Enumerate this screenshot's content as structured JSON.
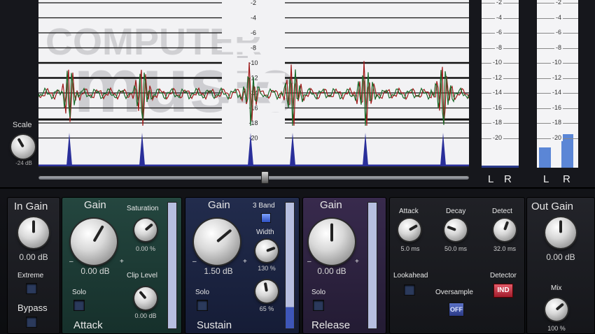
{
  "scope": {
    "scale_label": "Scale",
    "scale_value": "-24 dB",
    "watermark_top": "COMPUTER",
    "watermark_main": "music",
    "db_ticks": [
      "-2",
      "-4",
      "-6",
      "-8",
      "-10",
      "-12",
      "-14",
      "-16",
      "-18",
      "-20"
    ]
  },
  "meters": {
    "input_ticks": [
      "-2",
      "-4",
      "-6",
      "-8",
      "-10",
      "-12",
      "-14",
      "-16",
      "-18",
      "-20"
    ],
    "output_ticks": [
      "-2",
      "-4",
      "-6",
      "-8",
      "-10",
      "-12",
      "-14",
      "-16",
      "-18",
      "-20"
    ],
    "input_l": "L",
    "input_r": "R",
    "output_l": "L",
    "output_r": "R",
    "output_level_l": 0.12,
    "output_level_r": 0.2
  },
  "in_panel": {
    "title": "In Gain",
    "value": "0.00 dB",
    "extreme": "Extreme",
    "bypass": "Bypass"
  },
  "attack_panel": {
    "gain_title": "Gain",
    "gain_value": "0.00 dB",
    "saturation": "Saturation",
    "saturation_value": "0.00 %",
    "clip_level": "Clip Level",
    "clip_value": "0.00 dB",
    "solo": "Solo",
    "name": "Attack",
    "minus": "–",
    "plus": "+"
  },
  "sustain_panel": {
    "gain_title": "Gain",
    "gain_value": "1.50 dB",
    "three_band": "3 Band",
    "width": "Width",
    "width_value": "130 %",
    "third_value": "65 %",
    "solo": "Solo",
    "name": "Sustain",
    "minus": "–",
    "plus": "+"
  },
  "release_panel": {
    "gain_title": "Gain",
    "gain_value": "0.00 dB",
    "solo": "Solo",
    "name": "Release",
    "minus": "–",
    "plus": "+"
  },
  "env_panel": {
    "attack": "Attack",
    "attack_value": "5.0 ms",
    "decay": "Decay",
    "decay_value": "50.0 ms",
    "detect": "Detect",
    "detect_value": "32.0 ms",
    "lookahead": "Lookahead",
    "oversample": "Oversample",
    "oversample_btn": "OFF",
    "detector": "Detector",
    "detector_btn": "IND"
  },
  "out_panel": {
    "title": "Out Gain",
    "value": "0.00 dB",
    "mix": "Mix",
    "mix_value": "100 %"
  }
}
